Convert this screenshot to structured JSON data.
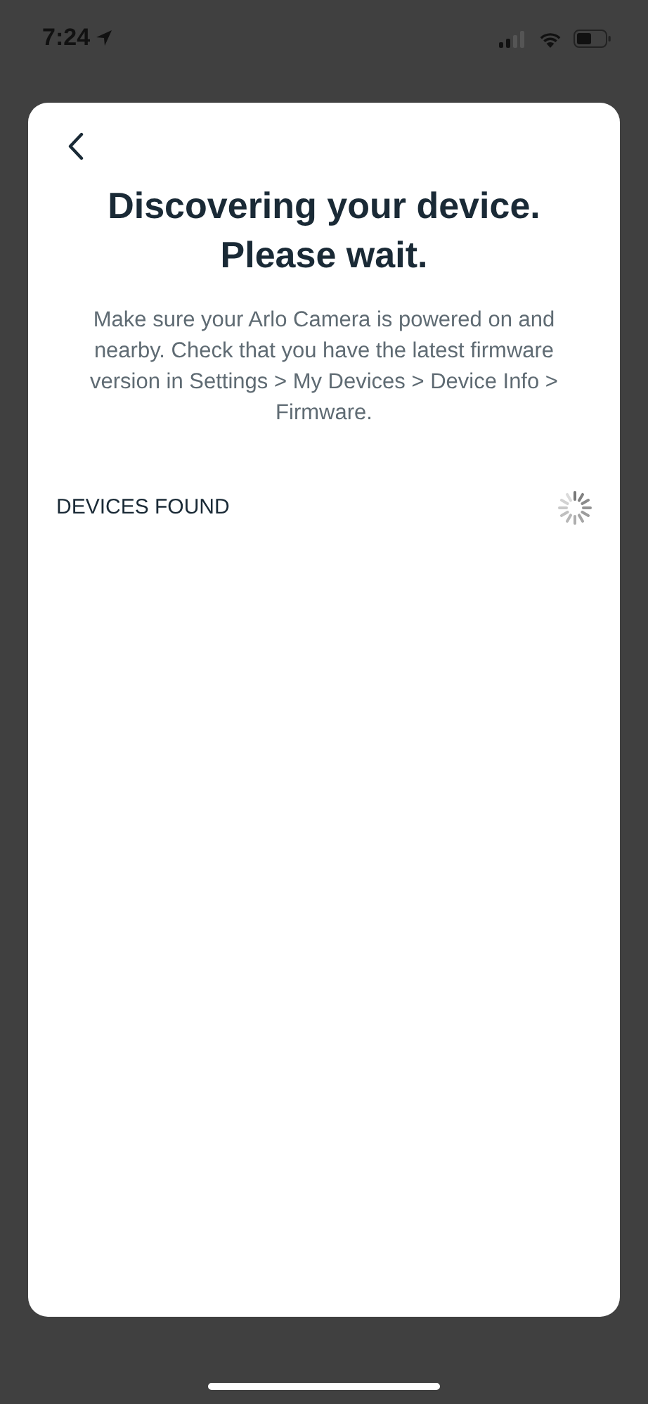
{
  "status_bar": {
    "time": "7:24"
  },
  "screen": {
    "title": "Discovering your device. Please wait.",
    "description": "Make sure your Arlo Camera is powered on and nearby. Check that you have the latest firmware version in Settings > My Devices > Device Info > Firmware.",
    "section_label": "DEVICES FOUND"
  }
}
